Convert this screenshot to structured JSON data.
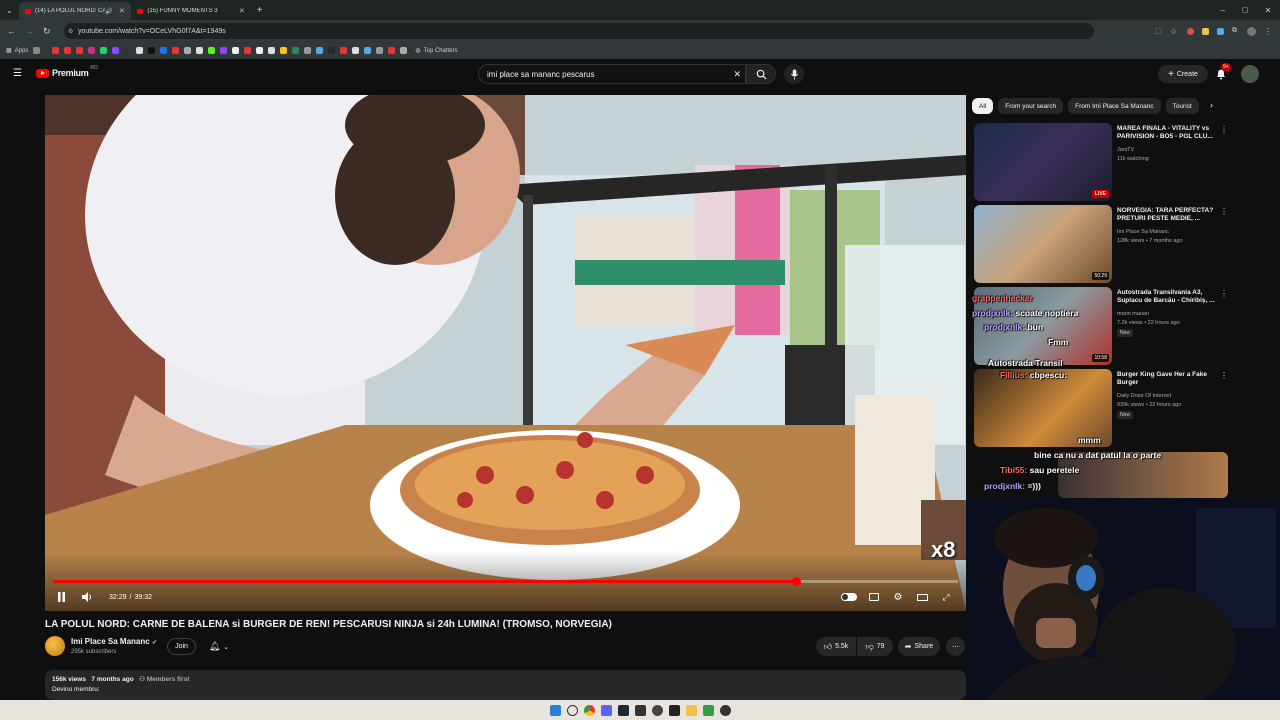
{
  "browser": {
    "tabs": [
      {
        "title": "(14) LA POLUL NORD: CAR",
        "active": true
      },
      {
        "title": "(15) FUNNY MOMENTS 3",
        "active": false
      }
    ],
    "new_tab": "+",
    "url": "youtube.com/watch?v=OCeLVhG0f7A&t=1949s",
    "bookmarks": {
      "apps": "Apps",
      "top_chatters": "Top Chatters"
    }
  },
  "yt": {
    "logo": "Premium",
    "logo_region": "RO",
    "search": {
      "value": "imi place sa mananc pescarus",
      "clear": "✕"
    },
    "create": "Create",
    "notif_count": "9+"
  },
  "player": {
    "time_current": "32:29",
    "time_sep": "/",
    "time_total": "39:32",
    "progress": 0.8216,
    "overlay_badge": "x8"
  },
  "video": {
    "title": "LA POLUL NORD: CARNE DE BALENA si BURGER DE REN! PESCARUSI NINJA si 24h LUMINA! (TROMSO, NORVEGIA)",
    "channel": "Imi Place Sa Mananc",
    "subscribers": "295k subscribers",
    "join": "Join",
    "likes": "5.5k",
    "dislikes": "79",
    "share": "Share",
    "views": "156k views",
    "age": "7 months ago",
    "members": "Members first",
    "desc_line": "Devino membru:"
  },
  "sidebar": {
    "chips": [
      "All",
      "From your search",
      "From Imi Place Sa Mananc",
      "Tourist"
    ],
    "recs": [
      {
        "title": "MAREA FINALA - VITALITY vs PARIVISION - BO5 - PGL CLU...",
        "channel": "JaniTV",
        "meta": "11k watching",
        "badge": "LIVE"
      },
      {
        "title": "NORVEGIA: TARA PERFECTA? PRETURI PESTE MEDIE, ...",
        "channel": "Imi Place Sa Mananc",
        "meta": "128k views • 7 months ago",
        "badge": "50:29"
      },
      {
        "title": "Autostrada Transilvania A3, Suplacu de Barcău - Chiribiș, ...",
        "channel": "marin marian",
        "meta": "7.2k views • 22 hours ago",
        "badge": "10:58",
        "new": "New"
      },
      {
        "title": "Burger King Gave Her a Fake Burger",
        "channel": "Daily Dose Of Internet",
        "meta": "939k views • 22 hours ago",
        "badge": "",
        "new": "New"
      }
    ]
  },
  "chat": {
    "lines": [
      {
        "user": "grappenhecker",
        "msg": ""
      },
      {
        "user": "prodjxnlk:",
        "msg": "scoate noptiera"
      },
      {
        "user": "prodjxnlk:",
        "msg": "bun"
      },
      {
        "user": "",
        "msg": "Fmm"
      },
      {
        "user": "",
        "msg": "Autostrada Transil"
      },
      {
        "user": "Fillius:",
        "msg": "cbpescu:"
      },
      {
        "user": "",
        "msg": "mmm"
      },
      {
        "user": "",
        "msg": "bine ca nu a dat patul la o parte"
      },
      {
        "user": "Tibi55:",
        "msg": "sau peretele"
      },
      {
        "user": "prodjxnlk:",
        "msg": "=)))"
      }
    ]
  },
  "colors": {
    "accent": "#ff0000",
    "bg": "#0f0f0f",
    "chip_bg": "#272727"
  }
}
